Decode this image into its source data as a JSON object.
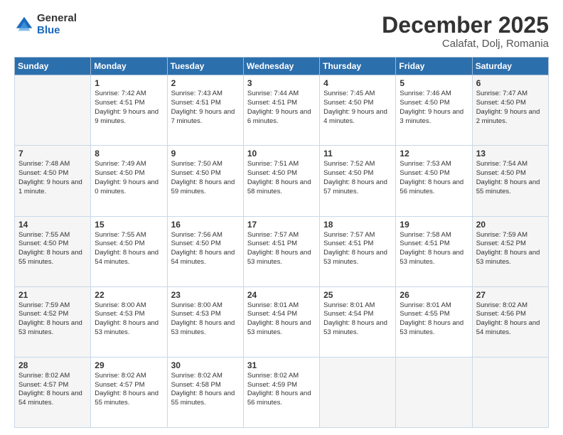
{
  "logo": {
    "general": "General",
    "blue": "Blue"
  },
  "title": "December 2025",
  "subtitle": "Calafat, Dolj, Romania",
  "weekdays": [
    "Sunday",
    "Monday",
    "Tuesday",
    "Wednesday",
    "Thursday",
    "Friday",
    "Saturday"
  ],
  "weeks": [
    [
      {
        "day": "",
        "sunrise": "",
        "sunset": "",
        "daylight": ""
      },
      {
        "day": "1",
        "sunrise": "Sunrise: 7:42 AM",
        "sunset": "Sunset: 4:51 PM",
        "daylight": "Daylight: 9 hours and 9 minutes."
      },
      {
        "day": "2",
        "sunrise": "Sunrise: 7:43 AM",
        "sunset": "Sunset: 4:51 PM",
        "daylight": "Daylight: 9 hours and 7 minutes."
      },
      {
        "day": "3",
        "sunrise": "Sunrise: 7:44 AM",
        "sunset": "Sunset: 4:51 PM",
        "daylight": "Daylight: 9 hours and 6 minutes."
      },
      {
        "day": "4",
        "sunrise": "Sunrise: 7:45 AM",
        "sunset": "Sunset: 4:50 PM",
        "daylight": "Daylight: 9 hours and 4 minutes."
      },
      {
        "day": "5",
        "sunrise": "Sunrise: 7:46 AM",
        "sunset": "Sunset: 4:50 PM",
        "daylight": "Daylight: 9 hours and 3 minutes."
      },
      {
        "day": "6",
        "sunrise": "Sunrise: 7:47 AM",
        "sunset": "Sunset: 4:50 PM",
        "daylight": "Daylight: 9 hours and 2 minutes."
      }
    ],
    [
      {
        "day": "7",
        "sunrise": "Sunrise: 7:48 AM",
        "sunset": "Sunset: 4:50 PM",
        "daylight": "Daylight: 9 hours and 1 minute."
      },
      {
        "day": "8",
        "sunrise": "Sunrise: 7:49 AM",
        "sunset": "Sunset: 4:50 PM",
        "daylight": "Daylight: 9 hours and 0 minutes."
      },
      {
        "day": "9",
        "sunrise": "Sunrise: 7:50 AM",
        "sunset": "Sunset: 4:50 PM",
        "daylight": "Daylight: 8 hours and 59 minutes."
      },
      {
        "day": "10",
        "sunrise": "Sunrise: 7:51 AM",
        "sunset": "Sunset: 4:50 PM",
        "daylight": "Daylight: 8 hours and 58 minutes."
      },
      {
        "day": "11",
        "sunrise": "Sunrise: 7:52 AM",
        "sunset": "Sunset: 4:50 PM",
        "daylight": "Daylight: 8 hours and 57 minutes."
      },
      {
        "day": "12",
        "sunrise": "Sunrise: 7:53 AM",
        "sunset": "Sunset: 4:50 PM",
        "daylight": "Daylight: 8 hours and 56 minutes."
      },
      {
        "day": "13",
        "sunrise": "Sunrise: 7:54 AM",
        "sunset": "Sunset: 4:50 PM",
        "daylight": "Daylight: 8 hours and 55 minutes."
      }
    ],
    [
      {
        "day": "14",
        "sunrise": "Sunrise: 7:55 AM",
        "sunset": "Sunset: 4:50 PM",
        "daylight": "Daylight: 8 hours and 55 minutes."
      },
      {
        "day": "15",
        "sunrise": "Sunrise: 7:55 AM",
        "sunset": "Sunset: 4:50 PM",
        "daylight": "Daylight: 8 hours and 54 minutes."
      },
      {
        "day": "16",
        "sunrise": "Sunrise: 7:56 AM",
        "sunset": "Sunset: 4:50 PM",
        "daylight": "Daylight: 8 hours and 54 minutes."
      },
      {
        "day": "17",
        "sunrise": "Sunrise: 7:57 AM",
        "sunset": "Sunset: 4:51 PM",
        "daylight": "Daylight: 8 hours and 53 minutes."
      },
      {
        "day": "18",
        "sunrise": "Sunrise: 7:57 AM",
        "sunset": "Sunset: 4:51 PM",
        "daylight": "Daylight: 8 hours and 53 minutes."
      },
      {
        "day": "19",
        "sunrise": "Sunrise: 7:58 AM",
        "sunset": "Sunset: 4:51 PM",
        "daylight": "Daylight: 8 hours and 53 minutes."
      },
      {
        "day": "20",
        "sunrise": "Sunrise: 7:59 AM",
        "sunset": "Sunset: 4:52 PM",
        "daylight": "Daylight: 8 hours and 53 minutes."
      }
    ],
    [
      {
        "day": "21",
        "sunrise": "Sunrise: 7:59 AM",
        "sunset": "Sunset: 4:52 PM",
        "daylight": "Daylight: 8 hours and 53 minutes."
      },
      {
        "day": "22",
        "sunrise": "Sunrise: 8:00 AM",
        "sunset": "Sunset: 4:53 PM",
        "daylight": "Daylight: 8 hours and 53 minutes."
      },
      {
        "day": "23",
        "sunrise": "Sunrise: 8:00 AM",
        "sunset": "Sunset: 4:53 PM",
        "daylight": "Daylight: 8 hours and 53 minutes."
      },
      {
        "day": "24",
        "sunrise": "Sunrise: 8:01 AM",
        "sunset": "Sunset: 4:54 PM",
        "daylight": "Daylight: 8 hours and 53 minutes."
      },
      {
        "day": "25",
        "sunrise": "Sunrise: 8:01 AM",
        "sunset": "Sunset: 4:54 PM",
        "daylight": "Daylight: 8 hours and 53 minutes."
      },
      {
        "day": "26",
        "sunrise": "Sunrise: 8:01 AM",
        "sunset": "Sunset: 4:55 PM",
        "daylight": "Daylight: 8 hours and 53 minutes."
      },
      {
        "day": "27",
        "sunrise": "Sunrise: 8:02 AM",
        "sunset": "Sunset: 4:56 PM",
        "daylight": "Daylight: 8 hours and 54 minutes."
      }
    ],
    [
      {
        "day": "28",
        "sunrise": "Sunrise: 8:02 AM",
        "sunset": "Sunset: 4:57 PM",
        "daylight": "Daylight: 8 hours and 54 minutes."
      },
      {
        "day": "29",
        "sunrise": "Sunrise: 8:02 AM",
        "sunset": "Sunset: 4:57 PM",
        "daylight": "Daylight: 8 hours and 55 minutes."
      },
      {
        "day": "30",
        "sunrise": "Sunrise: 8:02 AM",
        "sunset": "Sunset: 4:58 PM",
        "daylight": "Daylight: 8 hours and 55 minutes."
      },
      {
        "day": "31",
        "sunrise": "Sunrise: 8:02 AM",
        "sunset": "Sunset: 4:59 PM",
        "daylight": "Daylight: 8 hours and 56 minutes."
      },
      {
        "day": "",
        "sunrise": "",
        "sunset": "",
        "daylight": ""
      },
      {
        "day": "",
        "sunrise": "",
        "sunset": "",
        "daylight": ""
      },
      {
        "day": "",
        "sunrise": "",
        "sunset": "",
        "daylight": ""
      }
    ]
  ]
}
